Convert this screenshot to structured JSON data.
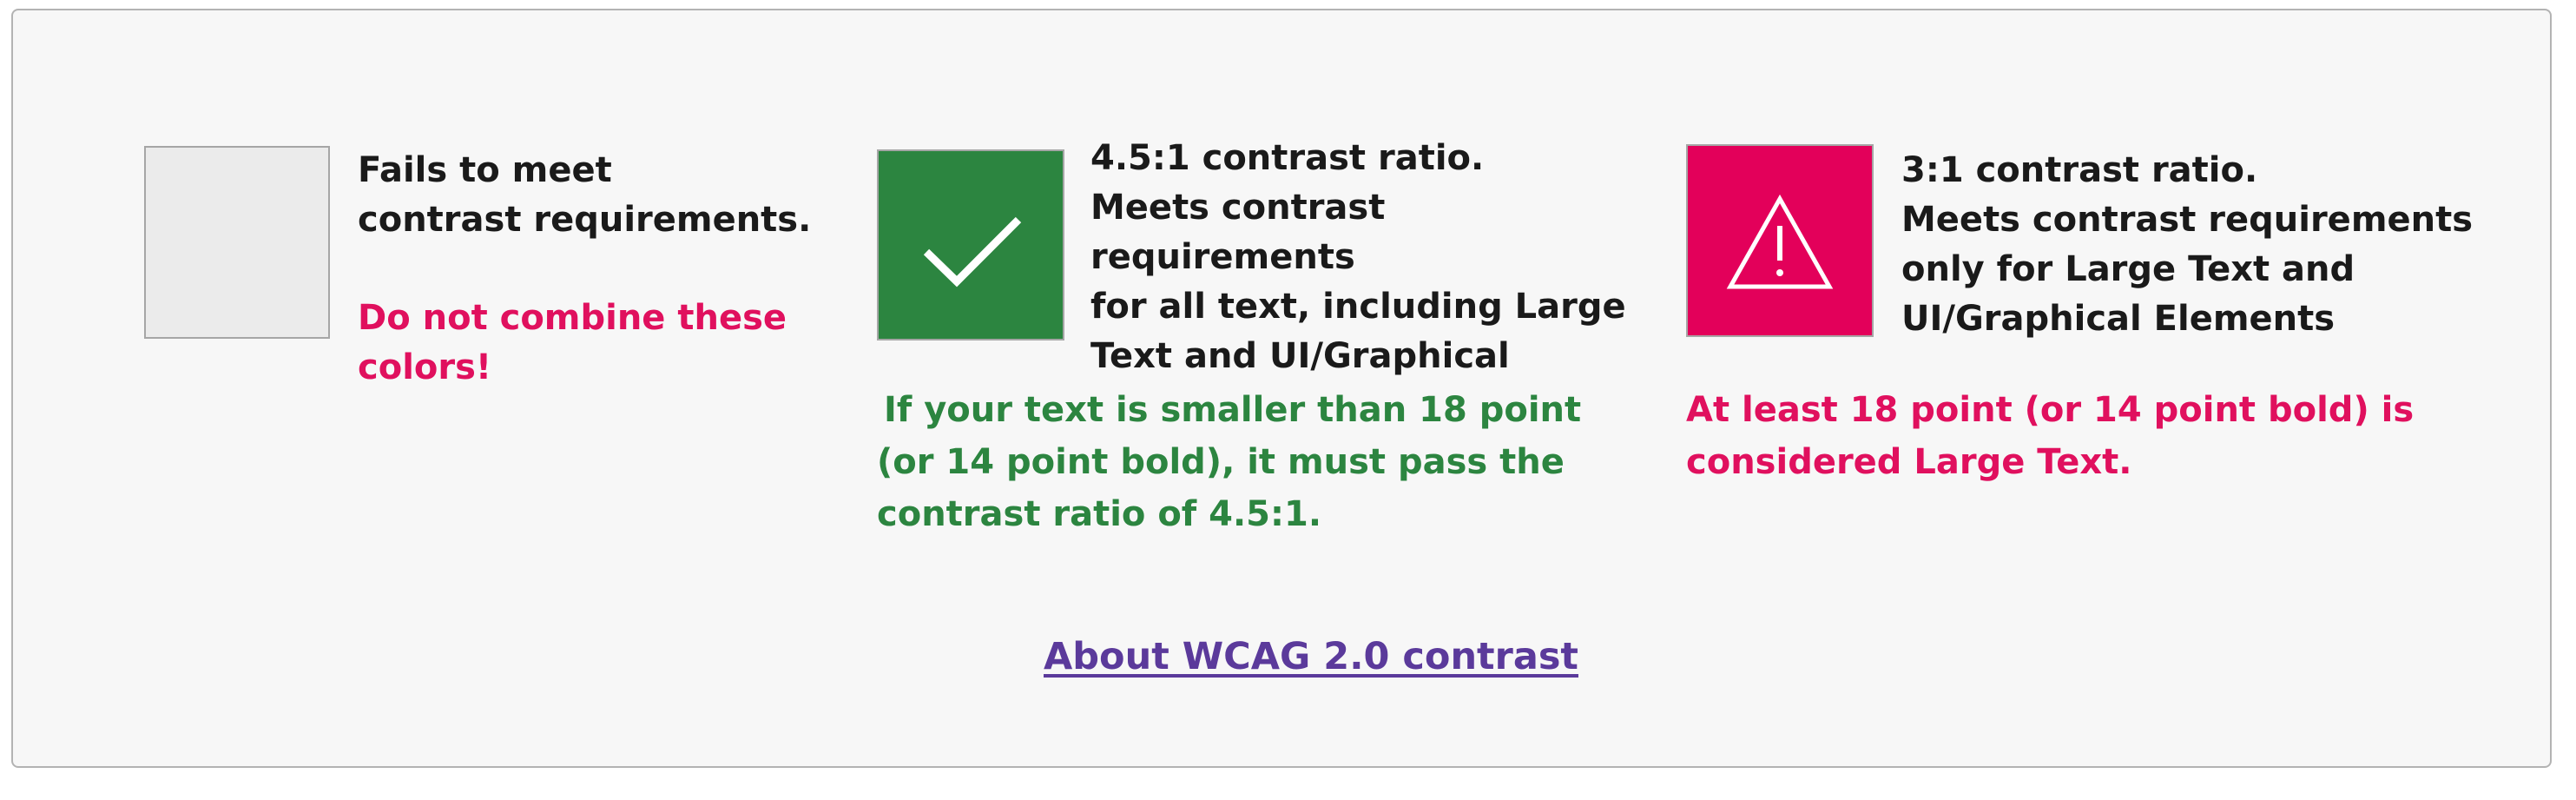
{
  "colors": {
    "panel_bg": "#f7f7f7",
    "fail_swatch": "#ebebeb",
    "pass_swatch": "#2c8540",
    "warn_swatch": "#e3005a",
    "fail_note": "#e0105e",
    "pass_note": "#2c8540",
    "warn_note": "#e0105e",
    "link": "#5b3a9b"
  },
  "fail": {
    "title_line1": "Fails to meet",
    "title_line2": "contrast requirements.",
    "note_line1": "Do not combine these",
    "note_line2": "colors!"
  },
  "pass": {
    "icon": "checkmark-icon",
    "title_line1": "4.5:1 contrast ratio.",
    "title_line2": "Meets contrast",
    "title_line3": "requirements",
    "title_line4": "for all text, including Large",
    "title_line5": "Text and UI/Graphical",
    "note_line1": "If your text is smaller than 18 point",
    "note_line2": "(or 14 point bold), it must pass the",
    "note_line3": "contrast ratio of 4.5:1."
  },
  "warn": {
    "icon": "warning-triangle-icon",
    "title_line1": "3:1 contrast ratio.",
    "title_line2": "Meets contrast requirements",
    "title_line3": "only for Large Text and",
    "title_line4": "UI/Graphical Elements",
    "note_line1": "At least 18 point (or 14 point bold) is",
    "note_line2": "considered Large Text."
  },
  "link": {
    "label": "About WCAG 2.0 contrast"
  }
}
